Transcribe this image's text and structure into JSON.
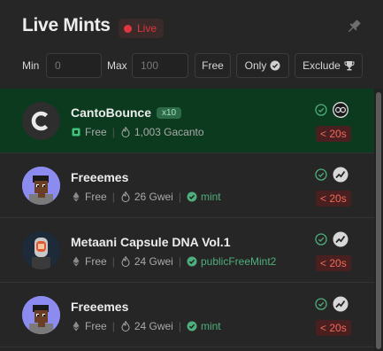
{
  "header": {
    "title": "Live Mints",
    "live_label": "Live"
  },
  "filters": {
    "min_label": "Min",
    "min_placeholder": "0",
    "max_label": "Max",
    "max_placeholder": "100",
    "free_label": "Free",
    "only_label": "Only",
    "exclude_label": "Exclude"
  },
  "mints": [
    {
      "name": "CantoBounce",
      "multiplier": "x10",
      "price": "Free",
      "volume": "1,003 Gacanto",
      "mint_fn": "",
      "chain_icon": "canto-chain-icon",
      "status_icon": "check-icon",
      "timer": "< 20s",
      "highlight": true
    },
    {
      "name": "Freeemes",
      "price": "Free",
      "volume": "26 Gwei",
      "mint_fn": "mint",
      "chain_icon": "ethereum-icon",
      "status_icon": "check-icon",
      "timer": "< 20s",
      "highlight": false
    },
    {
      "name": "Metaani Capsule DNA Vol.1",
      "price": "Free",
      "volume": "24 Gwei",
      "mint_fn": "publicFreeMint2",
      "chain_icon": "ethereum-icon",
      "status_icon": "check-icon",
      "timer": "< 20s",
      "highlight": false
    },
    {
      "name": "Freeemes",
      "price": "Free",
      "volume": "24 Gwei",
      "mint_fn": "mint",
      "chain_icon": "ethereum-icon",
      "status_icon": "check-icon",
      "timer": "< 20s",
      "highlight": false
    }
  ],
  "colors": {
    "live_red": "#e0363d",
    "highlight_green": "#0b3a1e",
    "fn_green": "#4fae7d",
    "timer_red": "#f06a5a"
  }
}
